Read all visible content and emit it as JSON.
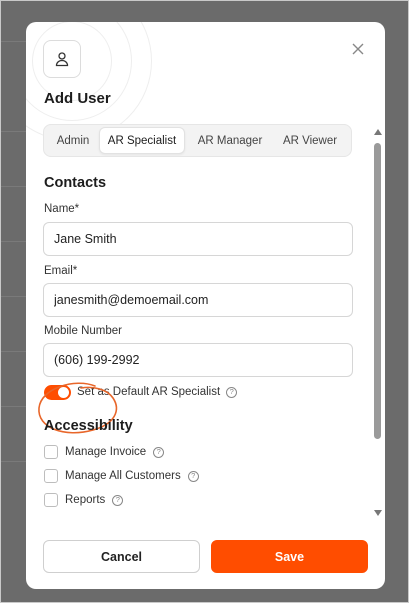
{
  "dialog": {
    "title": "Add User",
    "icons": {
      "user": "user-icon",
      "close": "close-icon"
    }
  },
  "tabs": [
    {
      "label": "Admin",
      "active": false
    },
    {
      "label": "AR Specialist",
      "active": true
    },
    {
      "label": "AR Manager",
      "active": false
    },
    {
      "label": "AR Viewer",
      "active": false
    }
  ],
  "contacts": {
    "section_title": "Contacts",
    "name": {
      "label": "Name*",
      "value": "Jane Smith"
    },
    "email": {
      "label": "Email*",
      "value": "janesmith@demoemail.com"
    },
    "mobile": {
      "label": "Mobile Number",
      "value": "(606) 199-2992"
    },
    "default_toggle": {
      "label": "Set as Default AR Specialist",
      "on": true
    }
  },
  "accessibility": {
    "section_title": "Accessibility",
    "items": [
      {
        "label": "Manage Invoice",
        "checked": false
      },
      {
        "label": "Manage All Customers",
        "checked": false
      },
      {
        "label": "Reports",
        "checked": false
      }
    ]
  },
  "footer": {
    "cancel_label": "Cancel",
    "save_label": "Save"
  },
  "colors": {
    "accent": "#ff4d00",
    "annotation": "#e8662a"
  }
}
